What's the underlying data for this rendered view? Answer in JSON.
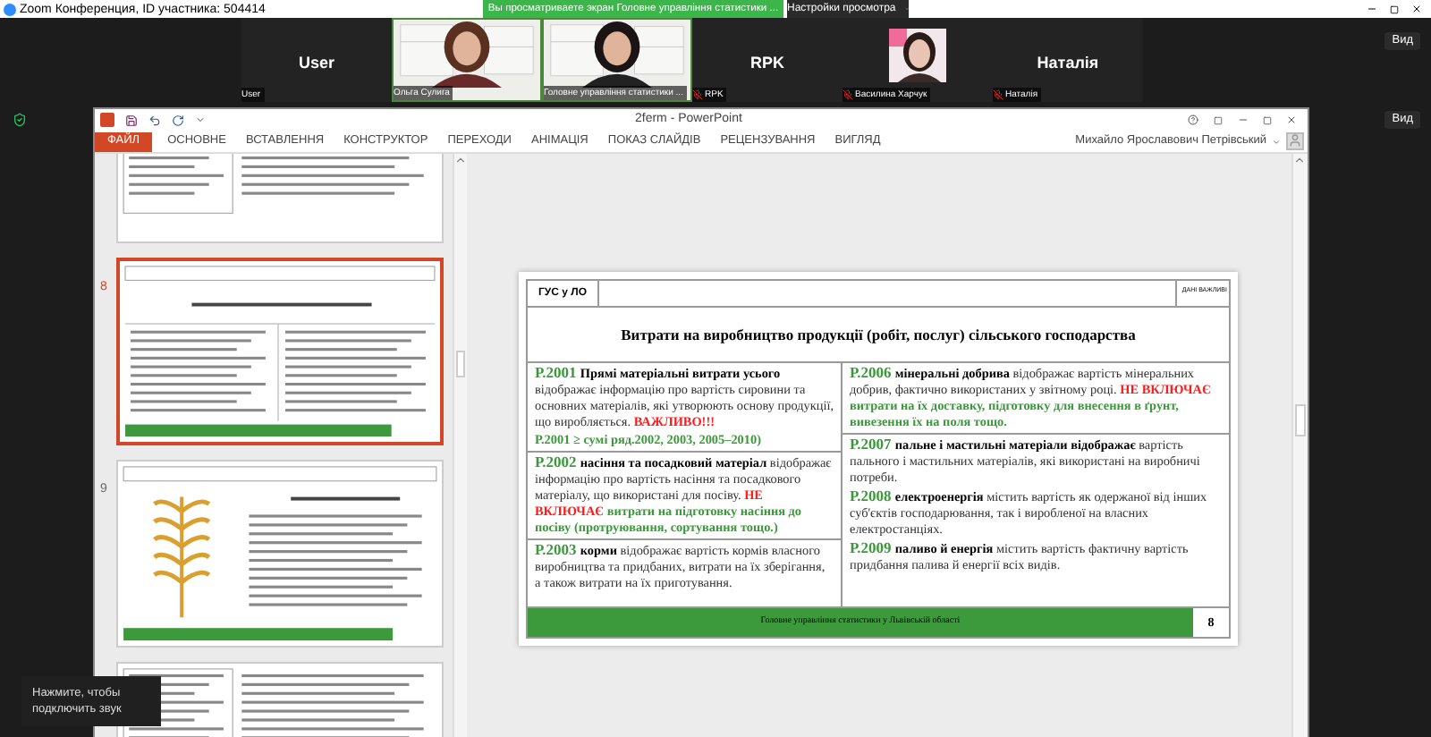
{
  "zoom_window": {
    "title": "Zoom Конференция, ID участника: 504414",
    "share_banner": "Вы просматриваете экран Головне управління статистики ...",
    "view_options": "Настройки просмотра"
  },
  "participants": [
    {
      "kind": "name",
      "name": "User",
      "label": "User",
      "muted": false
    },
    {
      "kind": "video",
      "label": "Ольга Сулига",
      "muted": false
    },
    {
      "kind": "video",
      "label": "Головне управління статистики ...",
      "muted": false
    },
    {
      "kind": "name",
      "name": "RPK",
      "label": "RPK",
      "muted": true
    },
    {
      "label": "Василина Харчук",
      "muted": true
    },
    {
      "kind": "name",
      "name": "Наталія",
      "label": "Наталія",
      "muted": true
    }
  ],
  "view_buttons": [
    "Вид",
    "Вид"
  ],
  "powerpoint": {
    "title": "2ferm - PowerPoint",
    "user": "Михайло Ярославович Петрівський",
    "tabs": [
      {
        "label": "ФАЙЛ",
        "kind": "file"
      },
      {
        "label": "ОСНОВНЕ",
        "kind": "tab"
      },
      {
        "label": "ВСТАВЛЕННЯ",
        "kind": "tab"
      },
      {
        "label": "КОНСТРУКТОР",
        "kind": "tab"
      },
      {
        "label": "ПЕРЕХОДИ",
        "kind": "tab"
      },
      {
        "label": "АНІМАЦІЯ",
        "kind": "tab"
      },
      {
        "label": "ПОКАЗ СЛАЙДІВ",
        "kind": "tab"
      },
      {
        "label": "РЕЦЕНЗУВАННЯ",
        "kind": "tab"
      },
      {
        "label": "ВИГЛЯД",
        "kind": "tab"
      }
    ]
  },
  "thumbnails": [
    {
      "kind": "text",
      "selected": false
    },
    {
      "kind": "grid",
      "number": "8",
      "selected": true
    },
    {
      "kind": "wheat",
      "number": "9",
      "selected": false
    },
    {
      "kind": "text",
      "selected": false
    }
  ],
  "slide": {
    "header_left": "ГУС у ЛО",
    "header_right": "ДАНІ ВАЖЛИВІ",
    "title": "Витрати на виробництво продукції (робіт, послуг) сільського господарства",
    "columns": [
      [
        {
          "paragraphs": [
            [
              {
                "kind": "code",
                "text": "Р.2001 "
              },
              {
                "kind": "bold",
                "text": "Прямі матеріальні витрати усього"
              },
              {
                "kind": "plain",
                "text": " відображає інформацію про вартість сировини та основних матеріалів, які утворюють основу продукції, що виробляється. "
              },
              {
                "kind": "alert",
                "text": "ВАЖЛИВО!!!"
              }
            ],
            [
              {
                "kind": "note",
                "text": "Р.2001  ≥ сумі ряд.2002, 2003, 2005–2010)"
              }
            ]
          ]
        },
        {
          "paragraphs": [
            [
              {
                "kind": "code",
                "text": "Р.2002 "
              },
              {
                "kind": "bold",
                "text": "насіння та посадковий матеріал"
              },
              {
                "kind": "plain",
                "text": " відображає інформацію про вартість насіння та посадкового матеріалу, що використані для посіву. "
              },
              {
                "kind": "alert",
                "text": "НЕ ВКЛЮЧАЄ"
              },
              {
                "kind": "note",
                "text": " витрати на підготовку насіння до посіву (протруювання, сортування тощо.)"
              }
            ]
          ]
        },
        {
          "paragraphs": [
            [
              {
                "kind": "code",
                "text": "Р.2003 "
              },
              {
                "kind": "bold",
                "text": "корми"
              },
              {
                "kind": "plain",
                "text": " відображає вартість кормів власного виробництва та придбаних, витрати на їх зберігання, а також витрати на їх приготування."
              }
            ]
          ]
        }
      ],
      [
        {
          "paragraphs": [
            [
              {
                "kind": "code",
                "text": "Р.2006 "
              },
              {
                "kind": "bold",
                "text": "мінеральні добрива"
              },
              {
                "kind": "plain",
                "text": " відображає вартість мінеральних добрив, фактично використаних у звітному році. "
              },
              {
                "kind": "alert",
                "text": "НЕ ВКЛЮЧАЄ"
              },
              {
                "kind": "note",
                "text": " витрати на їх доставку, підготовку для внесення в ґрунт, вивезення їх на поля тощо."
              }
            ]
          ]
        },
        {
          "paragraphs": [
            [
              {
                "kind": "code",
                "text": "Р.2007 "
              },
              {
                "kind": "bold",
                "text": "пальне і мастильні матеріали відображає"
              },
              {
                "kind": "plain",
                "text": " вартість пального і мастильних матеріалів, які використані на виробничі потреби."
              }
            ],
            [
              {
                "kind": "code",
                "text": "Р.2008 "
              },
              {
                "kind": "bold",
                "text": "електроенергія"
              },
              {
                "kind": "plain",
                "text": " містить вартість як одержаної від інших суб'єктів господарювання, так і виробленої на власних електростанціях."
              }
            ],
            [
              {
                "kind": "code",
                "text": "Р.2009 "
              },
              {
                "kind": "bold",
                "text": "паливо й енергія"
              },
              {
                "kind": "plain",
                "text": " містить вартість фактичну вартість придбання палива й енергії всіх видів."
              }
            ]
          ]
        }
      ]
    ],
    "footer": "Головне управління статистики у Львівській області",
    "page": "8"
  },
  "tooltip": "Нажмите, чтобы подключить звук"
}
